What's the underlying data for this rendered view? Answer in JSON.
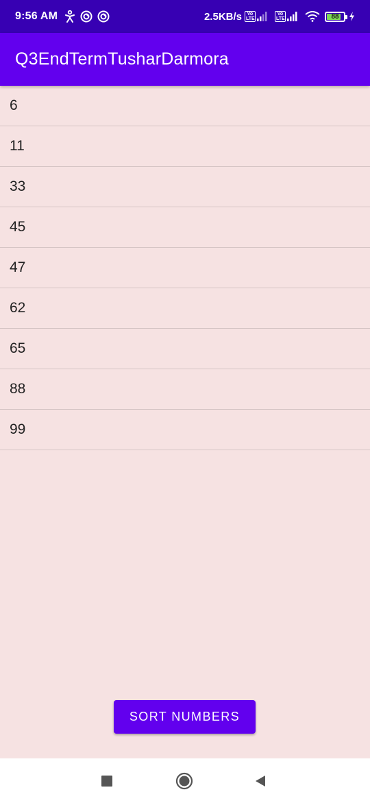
{
  "status_bar": {
    "time": "9:56 AM",
    "net_speed": "2.5KB/s",
    "volte_label_1": "Vo",
    "volte_label_2": "LTE",
    "battery_level": "88",
    "icons": [
      "accessibility-icon",
      "sync-icon",
      "sync-icon",
      "volte-icon",
      "signal-icon",
      "volte-icon",
      "signal-icon",
      "wifi-icon",
      "battery-icon",
      "charging-icon"
    ]
  },
  "app_bar": {
    "title": "Q3EndTermTusharDarmora"
  },
  "numbers": [
    "6",
    "11",
    "33",
    "45",
    "47",
    "62",
    "65",
    "88",
    "99"
  ],
  "sort_button": {
    "label": "SORT NUMBERS"
  },
  "nav_bar": {
    "icons": [
      "recents-icon",
      "home-icon",
      "back-icon"
    ]
  },
  "colors": {
    "status_bar": "#3700b3",
    "primary": "#6200ee",
    "background": "#f6e2e2",
    "divider": "#d5c4c4"
  }
}
